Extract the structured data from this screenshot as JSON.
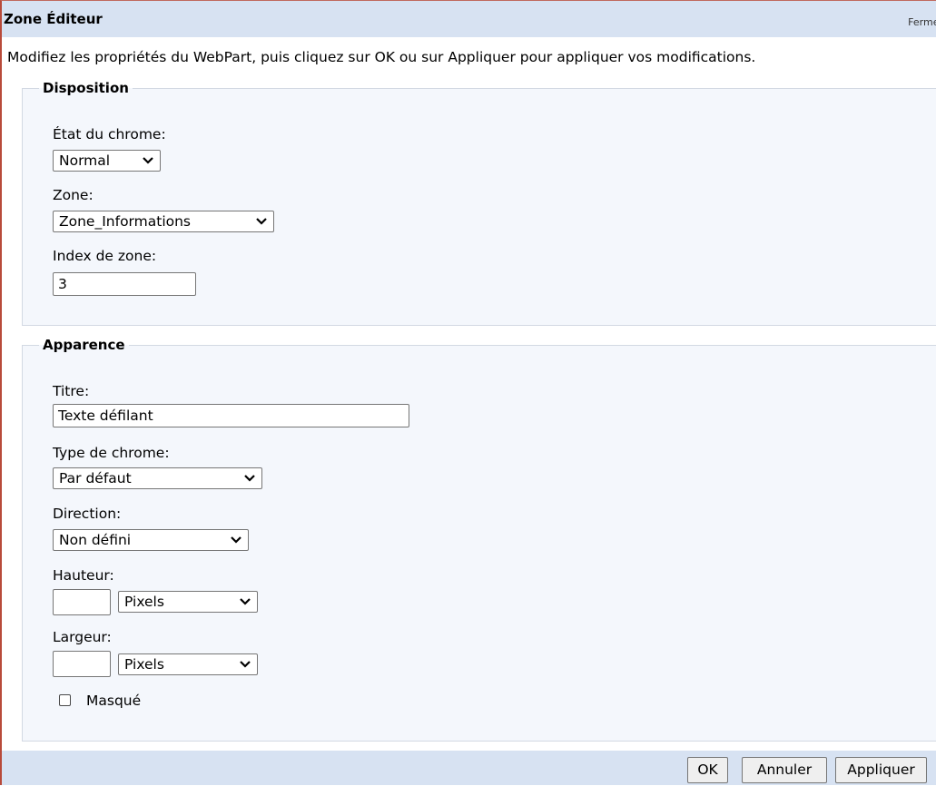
{
  "header": {
    "title": "Zone Éditeur",
    "close_label": "Fermer"
  },
  "intro_text": "Modifiez les propriétés du WebPart, puis cliquez sur OK ou sur Appliquer pour appliquer vos modifications.",
  "layout_section": {
    "legend": "Disposition",
    "chrome_state": {
      "label": "État du chrome:",
      "value": "Normal"
    },
    "zone": {
      "label": "Zone:",
      "value": "Zone_Informations"
    },
    "zone_index": {
      "label": "Index de zone:",
      "value": "3"
    }
  },
  "appearance_section": {
    "legend": "Apparence",
    "title_field": {
      "label": "Titre:",
      "value": "Texte défilant"
    },
    "chrome_type": {
      "label": "Type de chrome:",
      "value": "Par défaut"
    },
    "direction": {
      "label": "Direction:",
      "value": "Non défini"
    },
    "height": {
      "label": "Hauteur:",
      "value": "",
      "unit": "Pixels"
    },
    "width": {
      "label": "Largeur:",
      "value": "",
      "unit": "Pixels"
    },
    "hidden": {
      "label": "Masqué",
      "checked": false
    }
  },
  "buttons": {
    "ok": "OK",
    "cancel": "Annuler",
    "apply": "Appliquer"
  },
  "colors": {
    "header_bg": "#d7e2f2",
    "section_bg": "#f4f7fc",
    "frame_border": "#b84a3a"
  },
  "icons": {
    "dropdown": "chevron-down-icon"
  }
}
